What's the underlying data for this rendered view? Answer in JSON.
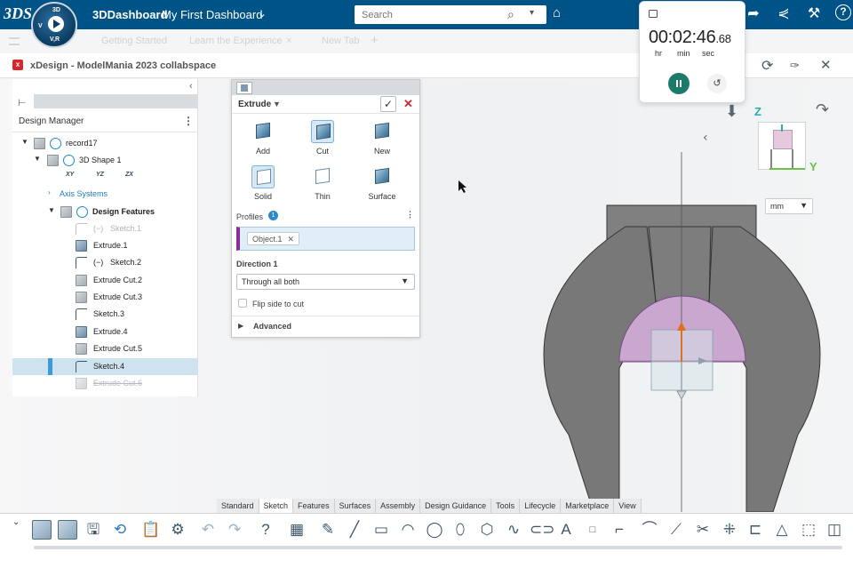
{
  "topbar": {
    "logo": "3DS",
    "compass": {
      "top": "3D",
      "left_letter": "V",
      "right_letter": "V,R"
    },
    "brand": "3DDashboard",
    "dashboard_name": "My First Dashboard",
    "search_placeholder": "Search"
  },
  "tabrow": {
    "tab1": "Getting Started",
    "tab2": "Learn the Experience",
    "tab3": "New Tab"
  },
  "app": {
    "title": "xDesign - ModelMania 2023 collabspace"
  },
  "design_manager": {
    "title": "Design Manager",
    "items": [
      {
        "label": "record17"
      },
      {
        "label": "3D Shape 1"
      },
      {
        "label": "XY"
      },
      {
        "label": "YZ"
      },
      {
        "label": "ZX"
      },
      {
        "label": "Axis Systems"
      },
      {
        "label": "Design Features"
      },
      {
        "label": "Sketch.1"
      },
      {
        "label": "Extrude.1"
      },
      {
        "label": "Sketch.2"
      },
      {
        "label": "Extrude Cut.2"
      },
      {
        "label": "Extrude Cut.3"
      },
      {
        "label": "Sketch.3"
      },
      {
        "label": "Extrude.4"
      },
      {
        "label": "Extrude Cut.5"
      },
      {
        "label": "Sketch.4"
      },
      {
        "label": "Extrude Cut.6"
      }
    ]
  },
  "extrude": {
    "title": "Extrude",
    "options_row1": [
      "Add",
      "Cut",
      "New"
    ],
    "options_row2": [
      "Solid",
      "Thin",
      "Surface"
    ],
    "profiles_label": "Profiles",
    "profiles_count": "1",
    "profile_chip": "Object.1",
    "direction_label": "Direction 1",
    "direction_value": "Through all both",
    "flip_label": "Flip side to cut",
    "advanced_label": "Advanced"
  },
  "timer": {
    "time": "00:02:46",
    "fraction": ".68",
    "units": [
      "hr",
      "min",
      "sec"
    ]
  },
  "viewport": {
    "axis_z": "Z",
    "axis_y": "Y",
    "units": "mm"
  },
  "command_tabs": [
    "Standard",
    "Sketch",
    "Features",
    "Surfaces",
    "Assembly",
    "Design Guidance",
    "Tools",
    "Lifecycle",
    "Marketplace",
    "View"
  ],
  "colors": {
    "topbar": "#005386",
    "accent": "#2f8ac9",
    "profile_fill": "#c9a7cf",
    "part_grey": "#7a7a7a",
    "timer_button": "#1c7a6b"
  }
}
